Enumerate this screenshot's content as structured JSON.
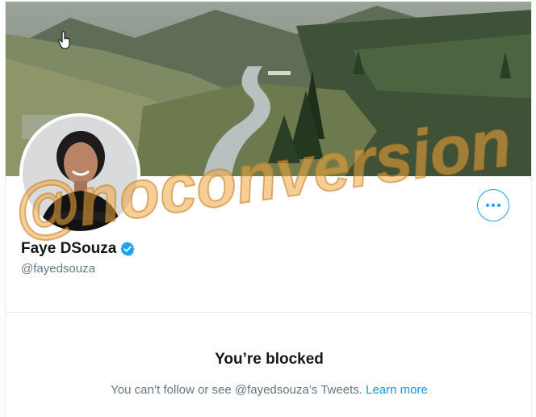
{
  "profile": {
    "display_name": "Faye DSouza",
    "handle": "@fayedsouza",
    "verified_icon": "verified-badge-icon"
  },
  "actions": {
    "more_icon": "more-horizontal-icon"
  },
  "blocked": {
    "title": "You’re blocked",
    "message": "You can’t follow or see @fayedsouza’s Tweets.",
    "link": "Learn more"
  },
  "watermark": {
    "text": "@noconversion"
  },
  "colors": {
    "accent": "#1da1f2",
    "link": "#1b95e0",
    "text_primary": "#14171a",
    "text_secondary": "#657786",
    "watermark": "#f0a640"
  }
}
